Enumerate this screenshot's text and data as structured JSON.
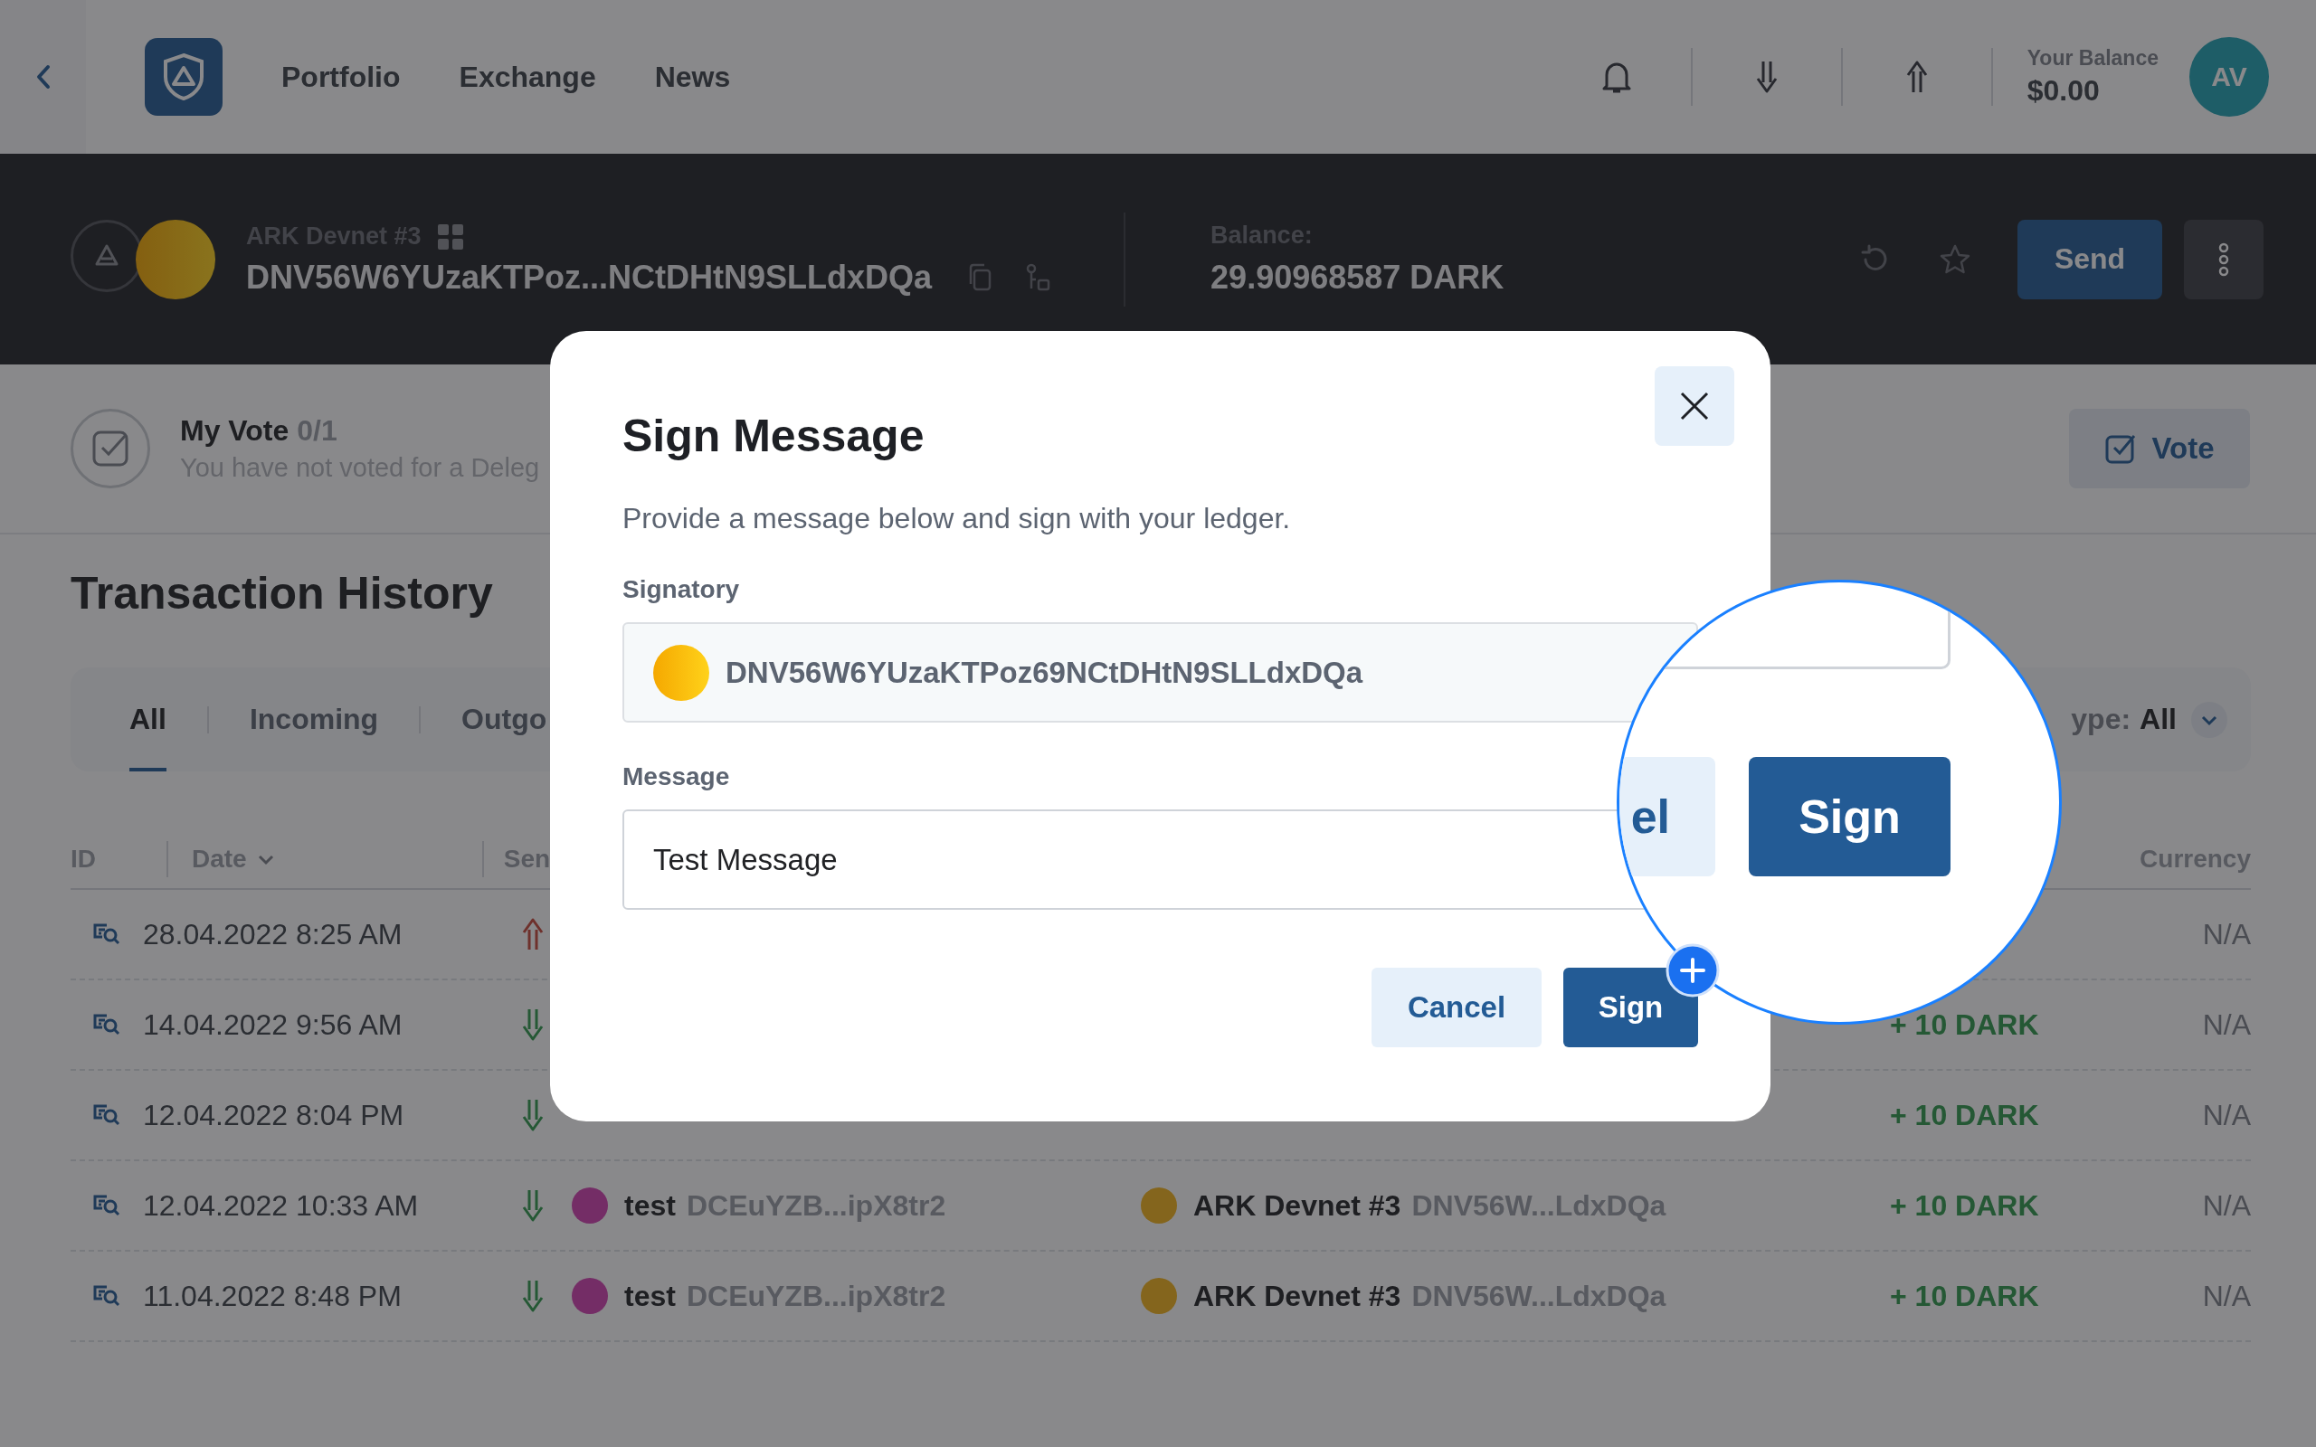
{
  "nav": {
    "links": [
      {
        "label": "Portfolio"
      },
      {
        "label": "Exchange"
      },
      {
        "label": "News"
      }
    ],
    "balance_label": "Your Balance",
    "balance": "$0.00",
    "avatar": "AV"
  },
  "wallet": {
    "name": "ARK Devnet #3",
    "address": "DNV56W6YUzaKTPoz...NCtDHtN9SLLdxDQa",
    "balance_label": "Balance:",
    "balance": "29.90968587 DARK",
    "send": "Send"
  },
  "vote": {
    "title": "My Vote",
    "count": "0/1",
    "subtitle": "You have not voted for a Deleg",
    "button": "Vote"
  },
  "history": {
    "title": "Transaction History",
    "tabs": [
      {
        "label": "All",
        "selected": true
      },
      {
        "label": "Incoming",
        "selected": false
      },
      {
        "label": "Outgo",
        "selected": false
      }
    ],
    "type_filter": {
      "label": "ype:",
      "value": "All"
    },
    "columns": {
      "id": "ID",
      "date": "Date",
      "sender": "Sen",
      "currency": "Currency"
    },
    "rows": [
      {
        "date": "28.04.2022 8:25 AM",
        "kind": "outgoing",
        "currency": "N/A"
      },
      {
        "date": "14.04.2022 9:56 AM",
        "kind": "incoming",
        "amount": "+ 10 DARK",
        "currency": "N/A"
      },
      {
        "date": "12.04.2022 8:04 PM",
        "kind": "incoming",
        "amount": "+ 10 DARK",
        "currency": "N/A"
      },
      {
        "date": "12.04.2022 10:33 AM",
        "kind": "incoming",
        "sender": {
          "name": "test",
          "address": "DCEuYZB...ipX8tr2"
        },
        "recipient": {
          "name": "ARK Devnet #3",
          "address": "DNV56W...LdxDQa"
        },
        "amount": "+ 10 DARK",
        "currency": "N/A"
      },
      {
        "date": "11.04.2022 8:48 PM",
        "kind": "incoming",
        "sender": {
          "name": "test",
          "address": "DCEuYZB...ipX8tr2"
        },
        "recipient": {
          "name": "ARK Devnet #3",
          "address": "DNV56W...LdxDQa"
        },
        "amount": "+ 10 DARK",
        "currency": "N/A"
      }
    ]
  },
  "modal": {
    "title": "Sign Message",
    "description": "Provide a message below and sign with your ledger.",
    "signatory_label": "Signatory",
    "signatory": "DNV56W6YUzaKTPoz69NCtDHtN9SLLdxDQa",
    "message_label": "Message",
    "message": "Test Message",
    "cancel": "Cancel",
    "sign": "Sign"
  },
  "magnifier": {
    "cancel_fragment": "el",
    "sign": "Sign"
  }
}
